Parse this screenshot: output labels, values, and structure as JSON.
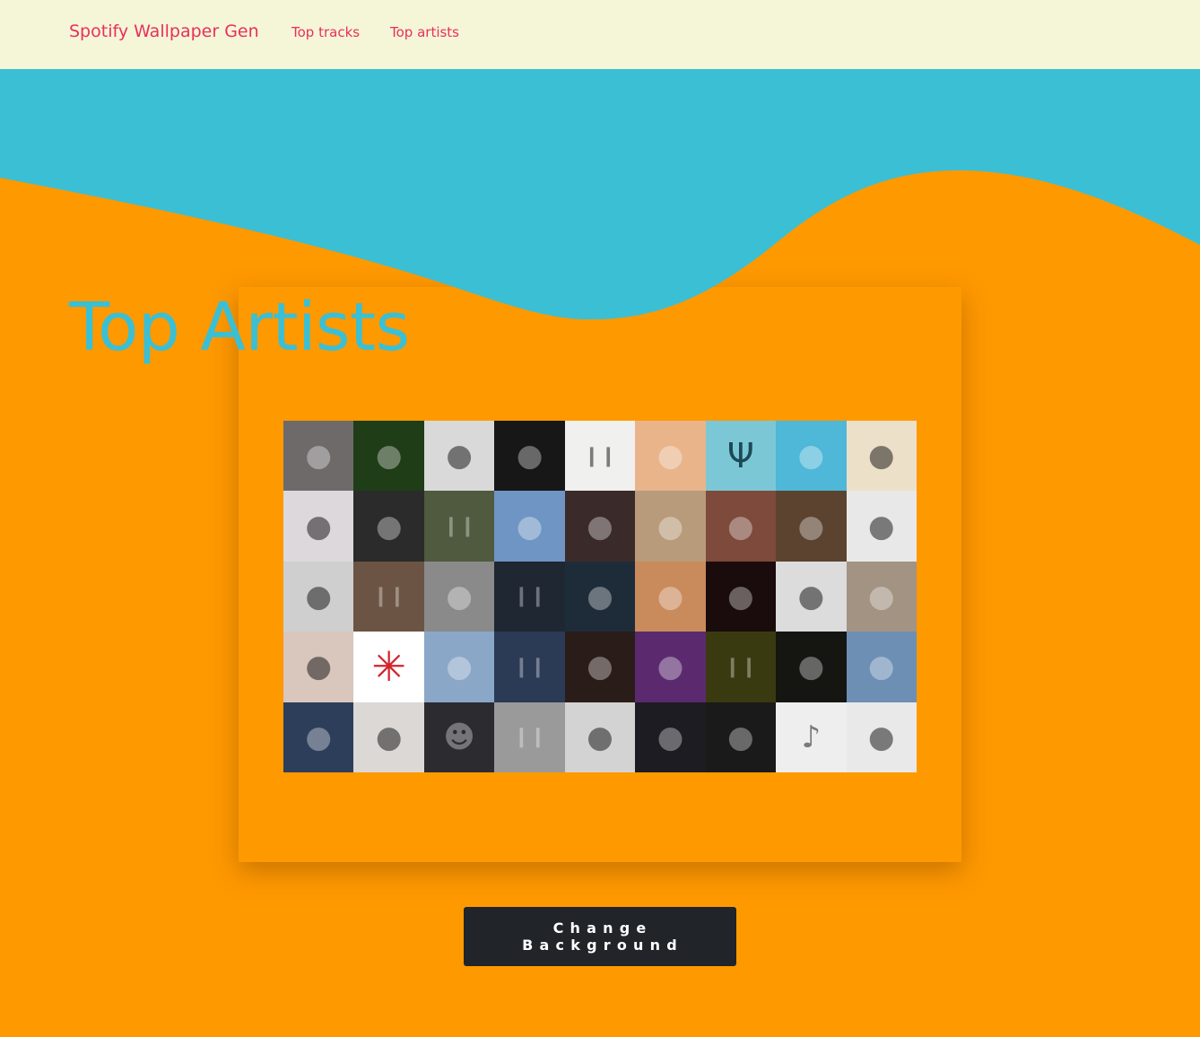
{
  "navbar": {
    "brand": "Spotify Wallpaper Gen",
    "links": [
      "Top tracks",
      "Top artists"
    ],
    "bg_color": "#f5f5d7",
    "link_color": "#e8305c"
  },
  "hero": {
    "title": "Top Artists",
    "title_color": "#3bbfd4"
  },
  "colors": {
    "background": "#ff9900",
    "wave": "#3bbfd4",
    "button": "#212529"
  },
  "wallpaper": {
    "columns": 9,
    "rows": 5,
    "tiles": [
      {
        "bg": "#6e6a6a",
        "icon": "person-icon"
      },
      {
        "bg": "#1f3d16",
        "icon": "person-icon"
      },
      {
        "bg": "#d9d9d9",
        "icon": "person-icon"
      },
      {
        "bg": "#171717",
        "icon": "person-icon"
      },
      {
        "bg": "#f0f0ee",
        "icon": "band-icon"
      },
      {
        "bg": "#e9b48a",
        "icon": "person-icon"
      },
      {
        "bg": "#7cc7d6",
        "icon": "logo-icon"
      },
      {
        "bg": "#4fb7d8",
        "icon": "person-icon"
      },
      {
        "bg": "#ede0c8",
        "icon": "person-icon"
      },
      {
        "bg": "#dcd8dc",
        "icon": "person-icon"
      },
      {
        "bg": "#2b2b2b",
        "icon": "person-icon"
      },
      {
        "bg": "#4f5a3e",
        "icon": "band-icon"
      },
      {
        "bg": "#6e95c4",
        "icon": "person-icon"
      },
      {
        "bg": "#3a2b2a",
        "icon": "person-icon"
      },
      {
        "bg": "#b89b7a",
        "icon": "person-icon"
      },
      {
        "bg": "#7d4a3c",
        "icon": "person-icon"
      },
      {
        "bg": "#5b4330",
        "icon": "person-icon"
      },
      {
        "bg": "#e8e8e8",
        "icon": "person-icon"
      },
      {
        "bg": "#cfcfcf",
        "icon": "person-icon"
      },
      {
        "bg": "#6b5443",
        "icon": "band-icon"
      },
      {
        "bg": "#8a8a8a",
        "icon": "person-icon"
      },
      {
        "bg": "#1f2733",
        "icon": "band-icon"
      },
      {
        "bg": "#1e2c3a",
        "icon": "person-icon"
      },
      {
        "bg": "#c98b5c",
        "icon": "person-icon"
      },
      {
        "bg": "#1a0c0c",
        "icon": "person-icon"
      },
      {
        "bg": "#dcdcdc",
        "icon": "person-icon"
      },
      {
        "bg": "#a39383",
        "icon": "person-icon"
      },
      {
        "bg": "#d9c6bd",
        "icon": "person-icon"
      },
      {
        "bg": "#ffffff",
        "icon": "rhcp-logo-icon"
      },
      {
        "bg": "#8aa7c8",
        "icon": "person-icon"
      },
      {
        "bg": "#2b3a55",
        "icon": "band-icon"
      },
      {
        "bg": "#2a1c18",
        "icon": "person-icon"
      },
      {
        "bg": "#5b2a6e",
        "icon": "person-icon"
      },
      {
        "bg": "#3a3a10",
        "icon": "band-icon"
      },
      {
        "bg": "#151512",
        "icon": "person-icon"
      },
      {
        "bg": "#6d8fb4",
        "icon": "person-icon"
      },
      {
        "bg": "#2d3e5a",
        "icon": "person-icon"
      },
      {
        "bg": "#dcd8d5",
        "icon": "person-icon"
      },
      {
        "bg": "#2b2b30",
        "icon": "figure-icon"
      },
      {
        "bg": "#9a9a9a",
        "icon": "band-icon"
      },
      {
        "bg": "#d3d3d3",
        "icon": "person-icon"
      },
      {
        "bg": "#1c1c22",
        "icon": "person-icon"
      },
      {
        "bg": "#1a1a1a",
        "icon": "person-icon"
      },
      {
        "bg": "#eeeeee",
        "icon": "guitar-icon"
      },
      {
        "bg": "#e9e9e9",
        "icon": "person-icon"
      }
    ]
  },
  "actions": {
    "change_background": "Change Background"
  }
}
